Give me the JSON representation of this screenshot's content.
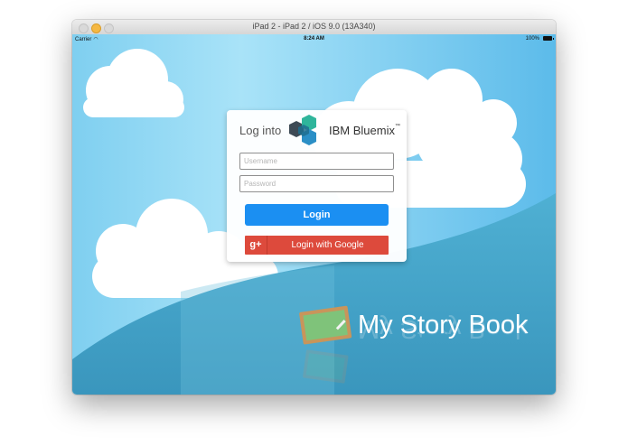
{
  "window": {
    "title": "iPad 2 - iPad 2 / iOS 9.0 (13A340)"
  },
  "status_bar": {
    "carrier": "Carrier",
    "time": "8:24 AM",
    "battery": "100%"
  },
  "login": {
    "title": "Log into",
    "brand": "IBM Bluemix",
    "trademark": "™",
    "username_placeholder": "Username",
    "password_placeholder": "Password",
    "login_button": "Login",
    "google_icon": "g+",
    "google_button": "Login with Google"
  },
  "app": {
    "name": "My Story Book"
  },
  "colors": {
    "sky": "#8fd6f2",
    "hill": "#4aa8c9",
    "primary_button": "#1b8ff2",
    "google_button": "#dd4a3c"
  }
}
